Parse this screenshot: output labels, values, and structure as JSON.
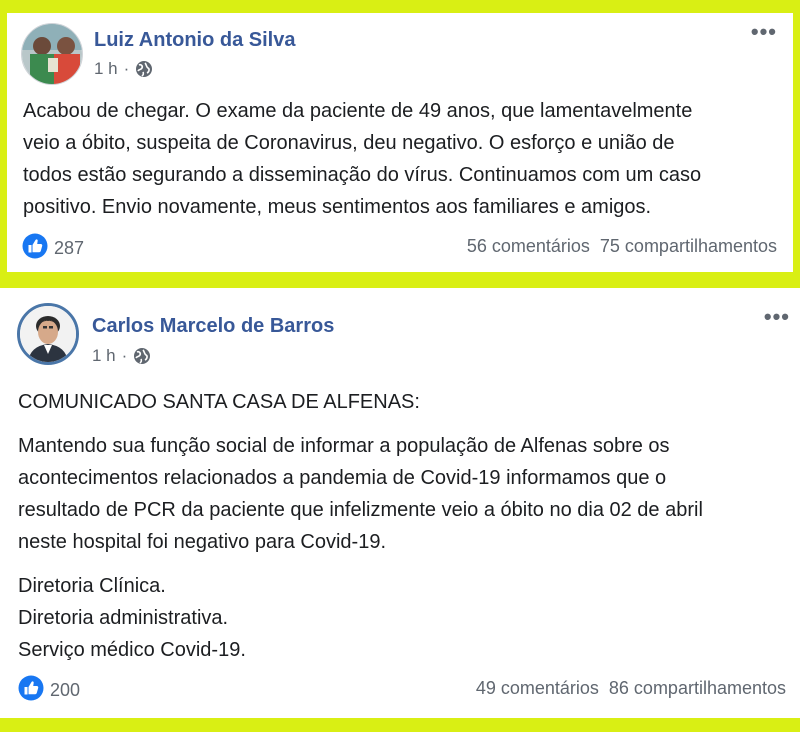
{
  "colors": {
    "background": "#d9ef14",
    "author_link": "#385898",
    "meta_text": "#606770",
    "like_blue": "#1877f2"
  },
  "posts": [
    {
      "author": "Luiz Antonio da Silva",
      "time": "1 h",
      "separator": "·",
      "privacy_icon": "globe-icon",
      "more_icon": "•••",
      "paragraphs": [
        "Acabou de chegar. O exame da paciente de 49 anos, que lamentavelmente\nveio a óbito, suspeita de Coronavirus, deu negativo. O esforço e união de\ntodos estão segurando a disseminação do vírus. Continuamos com um caso\npositivo. Envio novamente, meus sentimentos aos familiares e amigos."
      ],
      "likes": "287",
      "comments": "56 comentários",
      "shares": "75 compartilhamentos"
    },
    {
      "author": "Carlos Marcelo de Barros",
      "time": "1 h",
      "separator": "·",
      "privacy_icon": "globe-icon",
      "more_icon": "•••",
      "paragraphs": [
        "COMUNICADO SANTA CASA DE ALFENAS:",
        "Mantendo sua função social de informar a população de Alfenas sobre os\nacontecimentos relacionados a pandemia de Covid-19 informamos que o\nresultado de PCR da paciente que infelizmente veio a óbito no dia 02 de abril\nneste hospital foi negativo para Covid-19.",
        "Diretoria Clínica.\nDiretoria administrativa.\nServiço médico Covid-19."
      ],
      "likes": "200",
      "comments": "49 comentários",
      "shares": "86 compartilhamentos"
    }
  ]
}
